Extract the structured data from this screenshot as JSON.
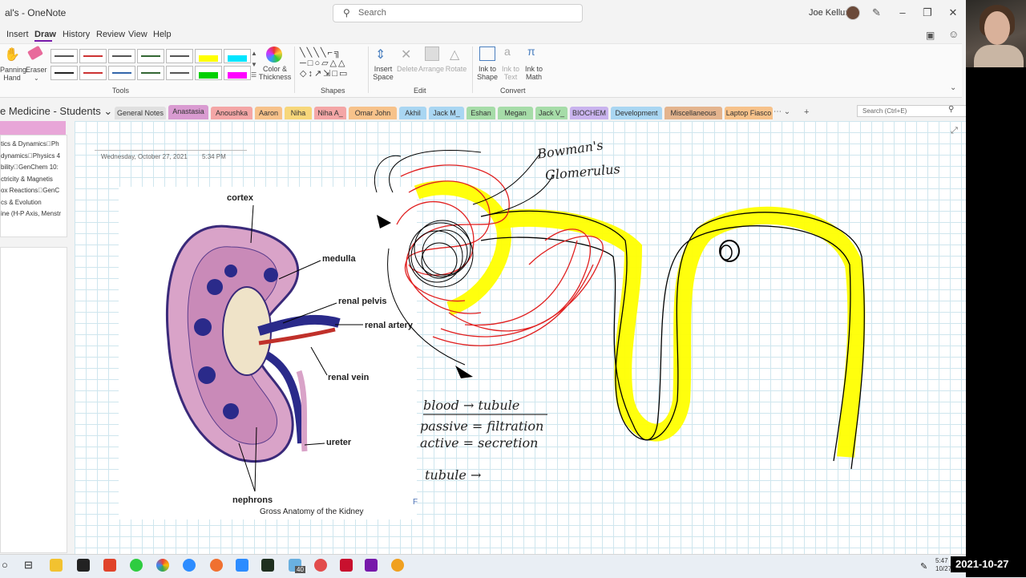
{
  "window": {
    "title": "al's  -  OneNote",
    "search_placeholder": "Search",
    "user_name": "Joe Kellum",
    "min_glyph": "–",
    "restore_glyph": "❐",
    "close_glyph": "✕"
  },
  "menu": {
    "items": [
      "Insert",
      "Draw",
      "History",
      "Review",
      "View",
      "Help"
    ],
    "active": "Draw"
  },
  "ribbon": {
    "panning": "Panning\nHand",
    "eraser": "Eraser",
    "color_thickness": "Color &\nThickness",
    "tools_label": "Tools",
    "shapes_label": "Shapes",
    "insert_space": "Insert\nSpace",
    "delete": "Delete",
    "arrange": "Arrange",
    "rotate": "Rotate",
    "edit_label": "Edit",
    "ink_to_shape": "Ink to\nShape",
    "ink_to_text": "Ink to\nText",
    "ink_to_math": "Ink to\nMath",
    "convert_label": "Convert",
    "pen_colors": [
      "#555555",
      "#cc3333",
      "#555555",
      "#336633",
      "#555555",
      "#ffff00",
      "#00e5ff",
      "#222222",
      "#cc3333",
      "#3366aa",
      "#336633",
      "#555555",
      "#00d000",
      "#ff00ff"
    ]
  },
  "notebook": {
    "title": "e Medicine - Students ⌄",
    "tabs": [
      {
        "label": "General Notes",
        "color": "#e0e0e0"
      },
      {
        "label": "Anastasia",
        "color": "#d99bd1"
      },
      {
        "label": "Anoushka",
        "color": "#f4a6a6"
      },
      {
        "label": "Aaron",
        "color": "#f7c28a"
      },
      {
        "label": "Niha",
        "color": "#f7d77a"
      },
      {
        "label": "Niha A_",
        "color": "#f4a6a6"
      },
      {
        "label": "Omar John",
        "color": "#f7c28a"
      },
      {
        "label": "Akhil",
        "color": "#a9d6f2"
      },
      {
        "label": "Jack M_",
        "color": "#a9d6f2"
      },
      {
        "label": "Eshan",
        "color": "#a6dca8"
      },
      {
        "label": "Megan",
        "color": "#a6dca8"
      },
      {
        "label": "Jack V_",
        "color": "#a6dca8"
      },
      {
        "label": "BIOCHEM",
        "color": "#c9b3ee"
      },
      {
        "label": "Development",
        "color": "#a9d6f2"
      },
      {
        "label": "Miscellaneous",
        "color": "#e4b48e"
      },
      {
        "label": "Laptop Fiasco",
        "color": "#f7c28a"
      }
    ],
    "search_placeholder": "Search (Ctrl+E)"
  },
  "pages": [
    "tics & Dynamics􀀀Ph",
    "dynamics􀀀Physics 4",
    "bility􀀀GenChem 10:",
    "ctricity & Magnetis",
    "ox Reactions􀀀GenC",
    "cs & Evolution",
    "ine (H-P Axis, Menstr"
  ],
  "note": {
    "date": "Wednesday, October 27, 2021",
    "time": "5:34 PM",
    "figure_caption": "Gross Anatomy of the Kidney",
    "figure_labels": {
      "cortex": "cortex",
      "medulla": "medulla",
      "renal_pelvis": "renal pelvis",
      "renal_artery": "renal artery",
      "renal_vein": "renal vein",
      "ureter": "ureter",
      "nephrons": "nephrons",
      "corner_letter": "F"
    },
    "handwriting": {
      "bowmans": "Bowman's",
      "glomerulus": "Glomerulus",
      "line1": "blood → tubule",
      "line2": "passive = filtration",
      "line3": "active = secretion",
      "line4": "tubule →"
    }
  },
  "taskbar": {
    "clock_time": "5:47",
    "clock_date": "10/27/2021",
    "badge": "40"
  },
  "overlay_timestamp": "2021-10-27"
}
